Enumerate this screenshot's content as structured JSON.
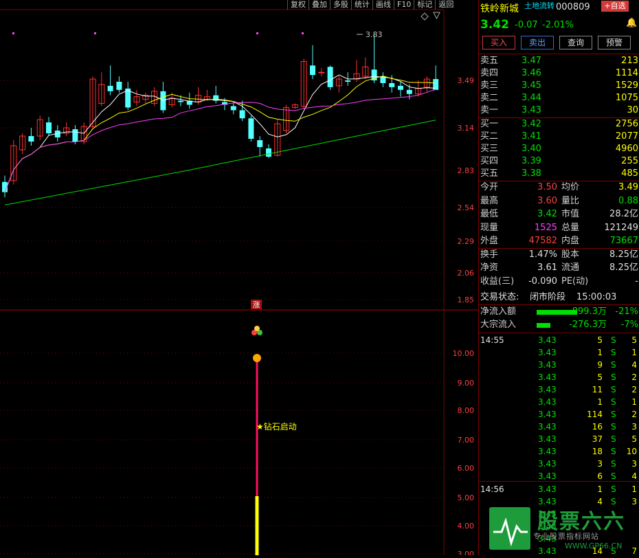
{
  "toolbar": [
    "复权",
    "叠加",
    "多股",
    "统计",
    "画线",
    "F10",
    "标记",
    "返回"
  ],
  "chart": {
    "price_axis": [
      "3.49",
      "3.14",
      "2.83",
      "2.54",
      "2.29",
      "2.06",
      "1.85"
    ],
    "peak_label": "3.83",
    "zhang_label": "涨",
    "indicator_axis": [
      "10.00",
      "9.00",
      "8.00",
      "7.00",
      "6.00",
      "5.00",
      "4.00",
      "3.00"
    ],
    "signal_label": "★钻石启动",
    "colors": {
      "up": "#ff3030",
      "down": "#54ffff",
      "ma5": "#ffffff",
      "ma10": "#ffff00",
      "ma20": "#ff40ff",
      "ma60": "#00e000",
      "grid": "#800000"
    }
  },
  "header": {
    "name": "铁岭新城",
    "tag": "土地流转",
    "code": "000809",
    "add": "+自选"
  },
  "quote": {
    "price": "3.42",
    "change": "-0.07",
    "pct": "-2.01%"
  },
  "buttons": {
    "buy": "买入",
    "sell": "卖出",
    "query": "查询",
    "alert": "预警"
  },
  "sell_orders": [
    {
      "label": "卖五",
      "price": "3.47",
      "vol": "213"
    },
    {
      "label": "卖四",
      "price": "3.46",
      "vol": "1114"
    },
    {
      "label": "卖三",
      "price": "3.45",
      "vol": "1529"
    },
    {
      "label": "卖二",
      "price": "3.44",
      "vol": "1075"
    },
    {
      "label": "卖一",
      "price": "3.43",
      "vol": "30"
    }
  ],
  "buy_orders": [
    {
      "label": "买一",
      "price": "3.42",
      "vol": "2756"
    },
    {
      "label": "买二",
      "price": "3.41",
      "vol": "2077"
    },
    {
      "label": "买三",
      "price": "3.40",
      "vol": "4960"
    },
    {
      "label": "买四",
      "price": "3.39",
      "vol": "255"
    },
    {
      "label": "买五",
      "price": "3.38",
      "vol": "485"
    }
  ],
  "stats": [
    {
      "l1": "今开",
      "v1": "3.50",
      "c1": "#ff4040",
      "l2": "均价",
      "v2": "3.49",
      "c2": "#ffff00"
    },
    {
      "l1": "最高",
      "v1": "3.60",
      "c1": "#ff4040",
      "l2": "量比",
      "v2": "0.88",
      "c2": "#00e000"
    },
    {
      "l1": "最低",
      "v1": "3.42",
      "c1": "#00e000",
      "l2": "市值",
      "v2": "28.2亿",
      "c2": "#e0e0e0"
    },
    {
      "l1": "现量",
      "v1": "1525",
      "c1": "#ff40ff",
      "l2": "总量",
      "v2": "121249",
      "c2": "#e0e0e0"
    },
    {
      "l1": "外盘",
      "v1": "47582",
      "c1": "#ff4040",
      "l2": "内盘",
      "v2": "73667",
      "c2": "#00e000"
    },
    {
      "l1": "换手",
      "v1": "1.47%",
      "c1": "#e0e0e0",
      "l2": "股本",
      "v2": "8.25亿",
      "c2": "#e0e0e0"
    },
    {
      "l1": "净资",
      "v1": "3.61",
      "c1": "#e0e0e0",
      "l2": "流通",
      "v2": "8.25亿",
      "c2": "#e0e0e0"
    },
    {
      "l1": "收益(三)",
      "v1": "-0.090",
      "c1": "#e0e0e0",
      "l2": "PE(动)",
      "v2": "-",
      "c2": "#e0e0e0"
    }
  ],
  "status": {
    "label": "交易状态:",
    "value": "闭市阶段",
    "time": "15:00:03"
  },
  "flows": [
    {
      "label": "净流入额",
      "value": "-899.3万",
      "pct": "-21%",
      "bar": 0.21
    },
    {
      "label": "大宗流入",
      "value": "-276.3万",
      "pct": "-7%",
      "bar": 0.07
    }
  ],
  "ticks": [
    {
      "time": "14:55",
      "price": "3.43",
      "vol": "5",
      "side": "S",
      "n": "5"
    },
    {
      "time": "",
      "price": "3.43",
      "vol": "1",
      "side": "S",
      "n": "1"
    },
    {
      "time": "",
      "price": "3.43",
      "vol": "9",
      "side": "S",
      "n": "4"
    },
    {
      "time": "",
      "price": "3.43",
      "vol": "5",
      "side": "S",
      "n": "2"
    },
    {
      "time": "",
      "price": "3.43",
      "vol": "11",
      "side": "S",
      "n": "2"
    },
    {
      "time": "",
      "price": "3.43",
      "vol": "1",
      "side": "S",
      "n": "1"
    },
    {
      "time": "",
      "price": "3.43",
      "vol": "114",
      "side": "S",
      "n": "2"
    },
    {
      "time": "",
      "price": "3.43",
      "vol": "16",
      "side": "S",
      "n": "3"
    },
    {
      "time": "",
      "price": "3.43",
      "vol": "37",
      "side": "S",
      "n": "5"
    },
    {
      "time": "",
      "price": "3.43",
      "vol": "18",
      "side": "S",
      "n": "10"
    },
    {
      "time": "",
      "price": "3.43",
      "vol": "3",
      "side": "S",
      "n": "3"
    },
    {
      "time": "",
      "price": "3.43",
      "vol": "6",
      "side": "S",
      "n": "4"
    },
    {
      "time": "14:56",
      "price": "3.43",
      "vol": "1",
      "side": "S",
      "n": "1"
    },
    {
      "time": "",
      "price": "3.43",
      "vol": "4",
      "side": "S",
      "n": "3"
    },
    {
      "time": "",
      "price": "3.43",
      "vol": "",
      "side": "",
      "n": ""
    },
    {
      "time": "",
      "price": "3.43",
      "vol": "",
      "side": "",
      "n": ""
    },
    {
      "time": "",
      "price": "3.43",
      "vol": "",
      "side": "",
      "n": ""
    },
    {
      "time": "",
      "price": "3.43",
      "vol": "14",
      "side": "S",
      "n": "7"
    }
  ],
  "watermark": {
    "brand": "股票六六",
    "url": "WWW.GP66.CN",
    "slogan": "专业股票指标网站"
  }
}
